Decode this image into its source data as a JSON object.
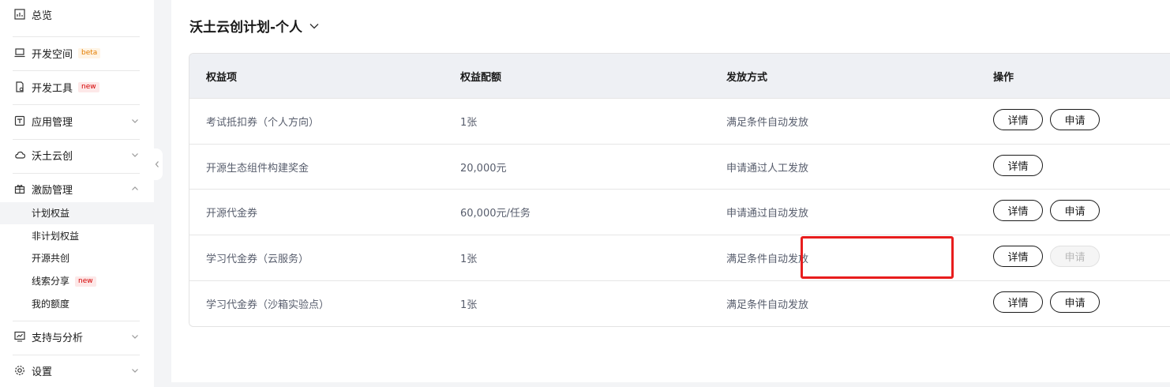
{
  "sidebar": {
    "items": [
      {
        "label": "总览",
        "icon": "overview-chart-icon"
      },
      {
        "label": "开发空间",
        "icon": "laptop-icon",
        "badge": "beta"
      },
      {
        "label": "开发工具",
        "icon": "tool-document-icon",
        "badge": "new"
      },
      {
        "label": "应用管理",
        "icon": "app-box-icon",
        "expanded": false
      },
      {
        "label": "沃土云创",
        "icon": "cloud-icon",
        "expanded": false
      },
      {
        "label": "激励管理",
        "icon": "gift-icon",
        "expanded": true
      },
      {
        "label": "支持与分析",
        "icon": "monitor-chart-icon",
        "expanded": false
      },
      {
        "label": "设置",
        "icon": "gear-icon",
        "expanded": false
      }
    ],
    "sub_items": [
      {
        "label": "计划权益",
        "active": true
      },
      {
        "label": "非计划权益"
      },
      {
        "label": "开源共创"
      },
      {
        "label": "线索分享",
        "badge": "new"
      },
      {
        "label": "我的额度"
      }
    ]
  },
  "main": {
    "title": "沃土云创计划-个人",
    "table": {
      "headers": [
        "权益项",
        "权益配额",
        "发放方式",
        "操作"
      ],
      "rows": [
        {
          "item": "考试抵扣券（个人方向）",
          "quota": "1张",
          "method": "满足条件自动发放",
          "detail": "详情",
          "apply": "申请",
          "apply_state": "enabled"
        },
        {
          "item": "开源生态组件构建奖金",
          "quota": "20,000元",
          "method": "申请通过人工发放",
          "detail": "详情"
        },
        {
          "item": "开源代金券",
          "quota": "60,000元/任务",
          "method": "申请通过自动发放",
          "detail": "详情",
          "apply": "申请",
          "apply_state": "enabled"
        },
        {
          "item": "学习代金券（云服务）",
          "quota": "1张",
          "method": "满足条件自动发放",
          "detail": "详情",
          "apply": "申请",
          "apply_state": "disabled"
        },
        {
          "item": "学习代金券（沙箱实验点）",
          "quota": "1张",
          "method": "满足条件自动发放",
          "detail": "详情",
          "apply": "申请",
          "apply_state": "enabled"
        }
      ]
    }
  },
  "colors": {
    "highlight": "#e81d1d",
    "badge_beta": "#e37d00",
    "badge_new": "#d40000",
    "header_bg": "#eef0f4"
  }
}
